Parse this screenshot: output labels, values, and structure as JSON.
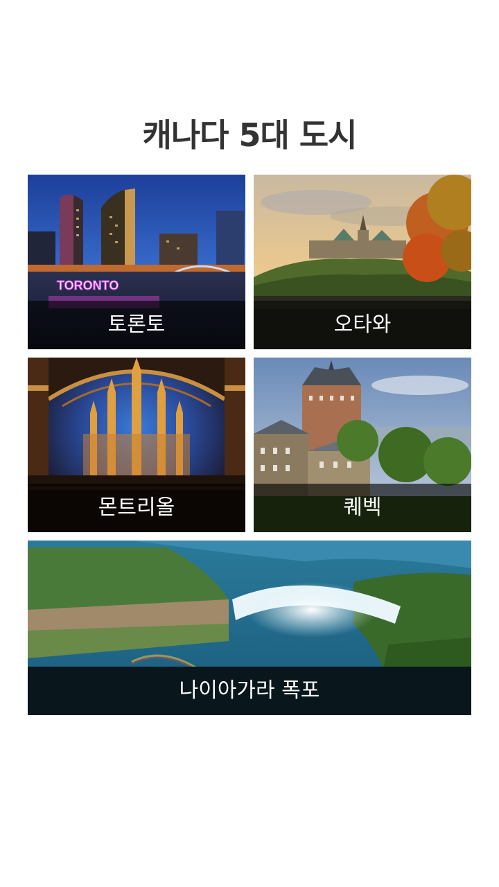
{
  "page": {
    "title": "캐나다 5대 도시"
  },
  "cities": [
    {
      "name": "토론토",
      "sign_text": "TORONTO",
      "image_icon": "toronto-city-hall-night-photo"
    },
    {
      "name": "오타와",
      "image_icon": "ottawa-parliament-hill-photo"
    },
    {
      "name": "몬트리올",
      "image_icon": "notre-dame-basilica-interior-photo"
    },
    {
      "name": "퀘벡",
      "image_icon": "chateau-frontenac-photo"
    },
    {
      "name": "나이아가라 폭포",
      "image_icon": "niagara-falls-aerial-photo"
    }
  ],
  "colors": {
    "title_text": "#333333",
    "caption_overlay": "#000000",
    "caption_text": "#ffffff"
  }
}
